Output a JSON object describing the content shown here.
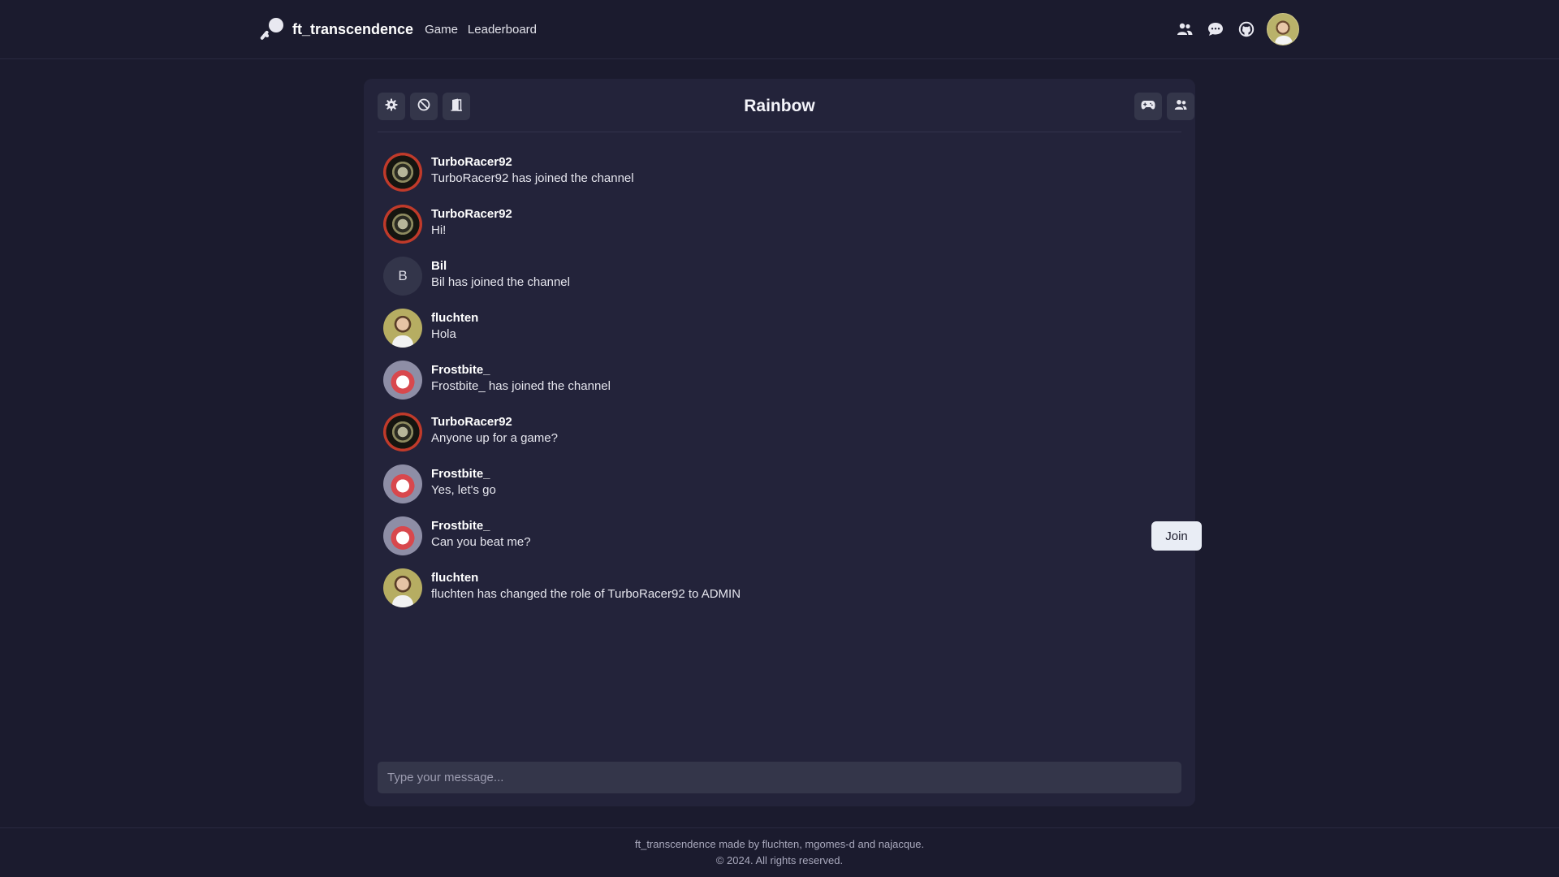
{
  "header": {
    "brand_name": "ft_transcendence",
    "nav": [
      {
        "label": "Game"
      },
      {
        "label": "Leaderboard"
      }
    ],
    "icons": [
      "friends-icon",
      "chat-bubble-icon",
      "github-icon"
    ]
  },
  "chat": {
    "channel_name": "Rainbow",
    "toolbar_left": [
      "settings-gear-icon",
      "ban-icon",
      "leave-door-icon"
    ],
    "toolbar_right": [
      "gamepad-icon",
      "members-icon"
    ],
    "messages": [
      {
        "author": "TurboRacer92",
        "text": "TurboRacer92 has joined the channel",
        "avatar": "turbo"
      },
      {
        "author": "TurboRacer92",
        "text": "Hi!",
        "avatar": "turbo"
      },
      {
        "author": "Bil",
        "text": "Bil has joined the channel",
        "avatar": "initial",
        "initial": "B"
      },
      {
        "author": "fluchten",
        "text": "Hola",
        "avatar": "fluchten"
      },
      {
        "author": "Frostbite_",
        "text": "Frostbite_ has joined the channel",
        "avatar": "frost"
      },
      {
        "author": "TurboRacer92",
        "text": "Anyone up for a game?",
        "avatar": "turbo"
      },
      {
        "author": "Frostbite_",
        "text": "Yes, let's go",
        "avatar": "frost"
      },
      {
        "author": "Frostbite_",
        "text": "Can you beat me?",
        "avatar": "frost",
        "action_label": "Join"
      },
      {
        "author": "fluchten",
        "text": "fluchten has changed the role of TurboRacer92 to ADMIN",
        "avatar": "fluchten"
      }
    ],
    "composer_placeholder": "Type your message..."
  },
  "footer": {
    "line1": "ft_transcendence made by fluchten, mgomes-d and najacque.",
    "line2": "© 2024. All rights reserved."
  },
  "colors": {
    "background": "#1b1b2e",
    "panel": "#23233a",
    "button": "#34364a",
    "join_button": "#e9edf5"
  }
}
